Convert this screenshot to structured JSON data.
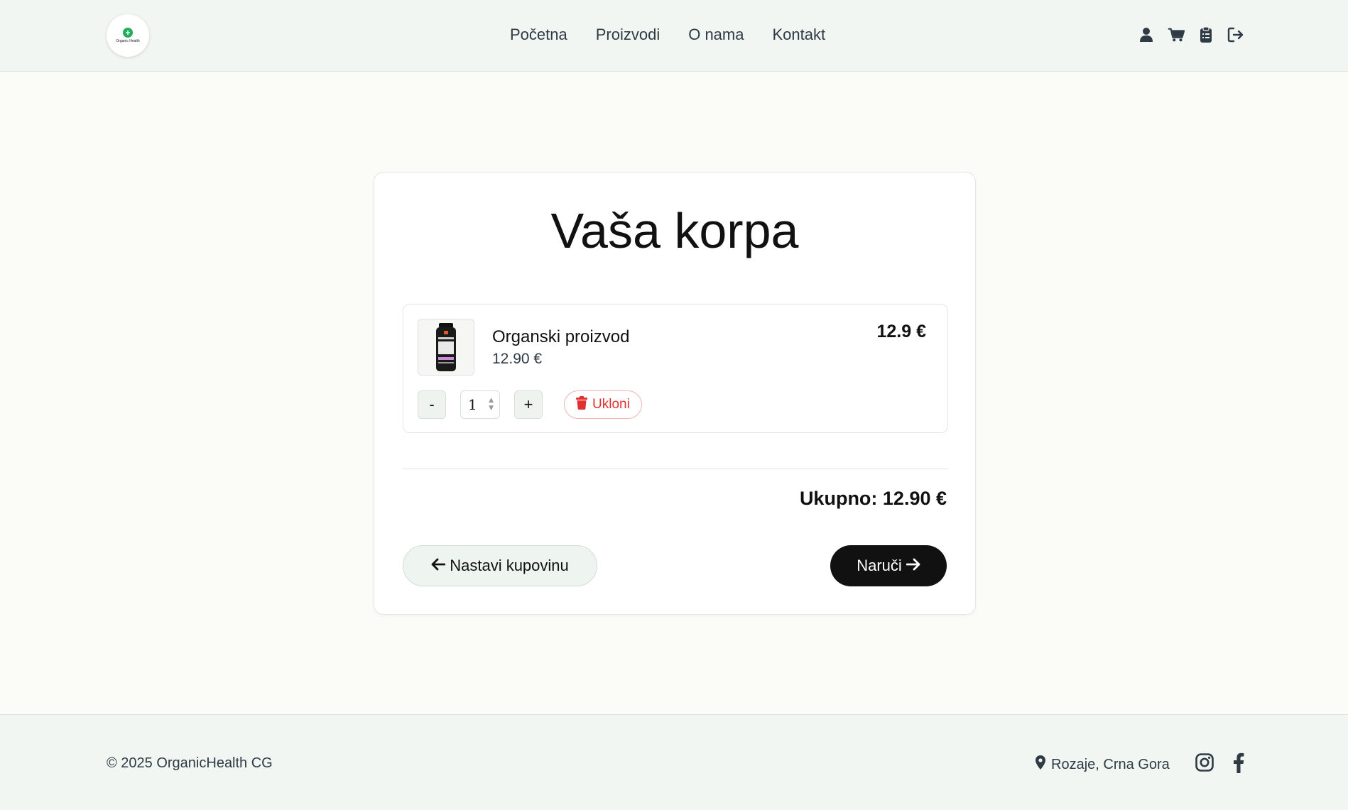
{
  "header": {
    "logo_text": "Organic Health",
    "nav": [
      "Početna",
      "Proizvodi",
      "O nama",
      "Kontakt"
    ],
    "icons": [
      "user-icon",
      "cart-icon",
      "clipboard-icon",
      "logout-icon"
    ]
  },
  "cart": {
    "title": "Vaša korpa",
    "items": [
      {
        "name": "Organski proizvod",
        "unit_price": "12.90 €",
        "line_total": "12.9 €",
        "quantity": "1",
        "minus_label": "-",
        "plus_label": "+",
        "remove_label": "Ukloni"
      }
    ],
    "total": "Ukupno: 12.90 €",
    "continue_label": "Nastavi kupovinu",
    "order_label": "Naruči"
  },
  "footer": {
    "copyright": "© 2025 OrganicHealth CG",
    "location": "Rozaje, Crna Gora",
    "social_icons": [
      "instagram-icon",
      "facebook-icon"
    ]
  },
  "colors": {
    "page_bg": "#fbfcf7",
    "header_bg": "#f1f6f2",
    "primary_dark": "#111111",
    "danger": "#e03131",
    "logo_green": "#1fae5b"
  }
}
